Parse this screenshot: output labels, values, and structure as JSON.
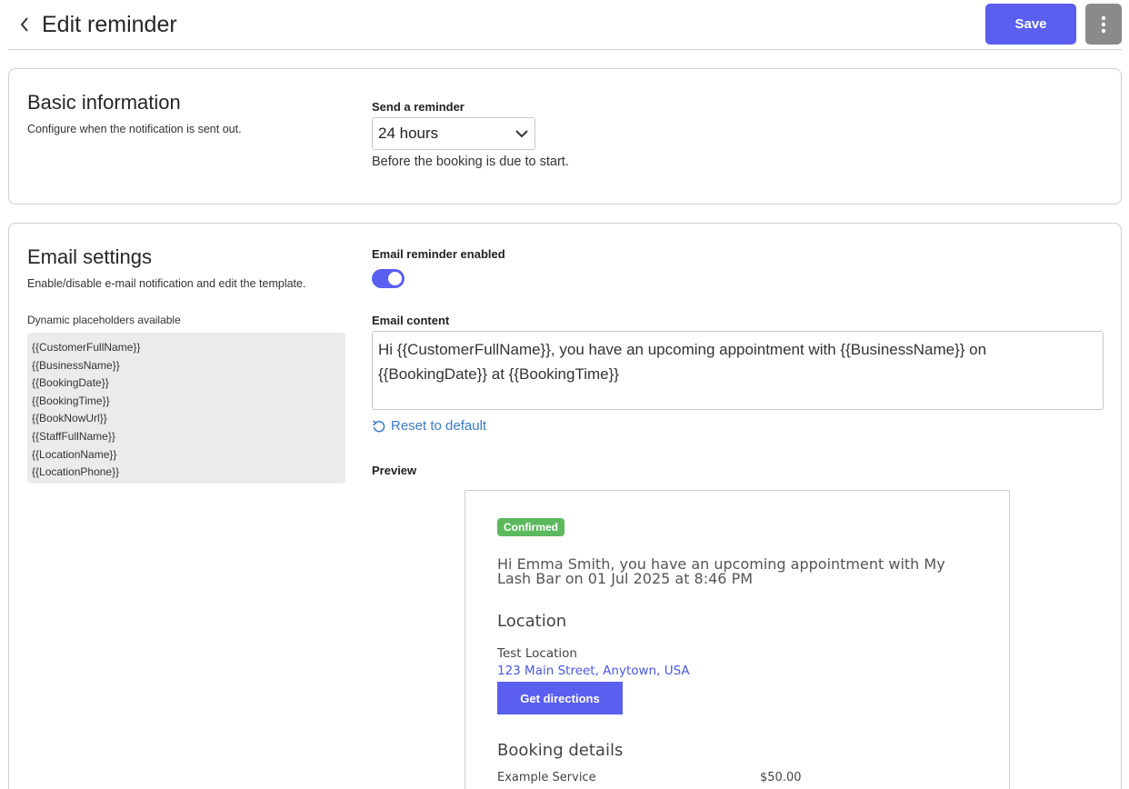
{
  "header": {
    "title": "Edit reminder",
    "save_label": "Save"
  },
  "basic": {
    "title": "Basic information",
    "description": "Configure when the notification is sent out.",
    "send_label": "Send a reminder",
    "send_value": "24 hours",
    "helper": "Before the booking is due to start."
  },
  "email": {
    "title": "Email settings",
    "description": "Enable/disable e-mail notification and edit the template.",
    "placeholders_label": "Dynamic placeholders available",
    "placeholders": [
      "{{CustomerFullName}}",
      "{{BusinessName}}",
      "{{BookingDate}}",
      "{{BookingTime}}",
      "{{BookNowUrl}}",
      "{{StaffFullName}}",
      "{{LocationName}}",
      "{{LocationPhone}}"
    ],
    "enabled_label": "Email reminder enabled",
    "enabled": true,
    "content_label": "Email content",
    "content": "Hi {{CustomerFullName}}, you have an upcoming appointment with {{BusinessName}} on {{BookingDate}} at {{BookingTime}}",
    "reset_label": "Reset to default",
    "preview_label": "Preview"
  },
  "preview": {
    "badge": "Confirmed",
    "message": "Hi Emma Smith, you have an upcoming appointment with My Lash Bar on 01 Jul 2025 at 8:46 PM",
    "location_heading": "Location",
    "location_name": "Test Location",
    "address": "123 Main Street, Anytown, USA",
    "directions_label": "Get directions",
    "booking_heading": "Booking details",
    "service": "Example Service",
    "price": "$50.00"
  },
  "colors": {
    "accent": "#5a5ff0",
    "more_button": "#8a8a8a",
    "badge": "#5cb85c",
    "link": "#3a7ac8"
  }
}
